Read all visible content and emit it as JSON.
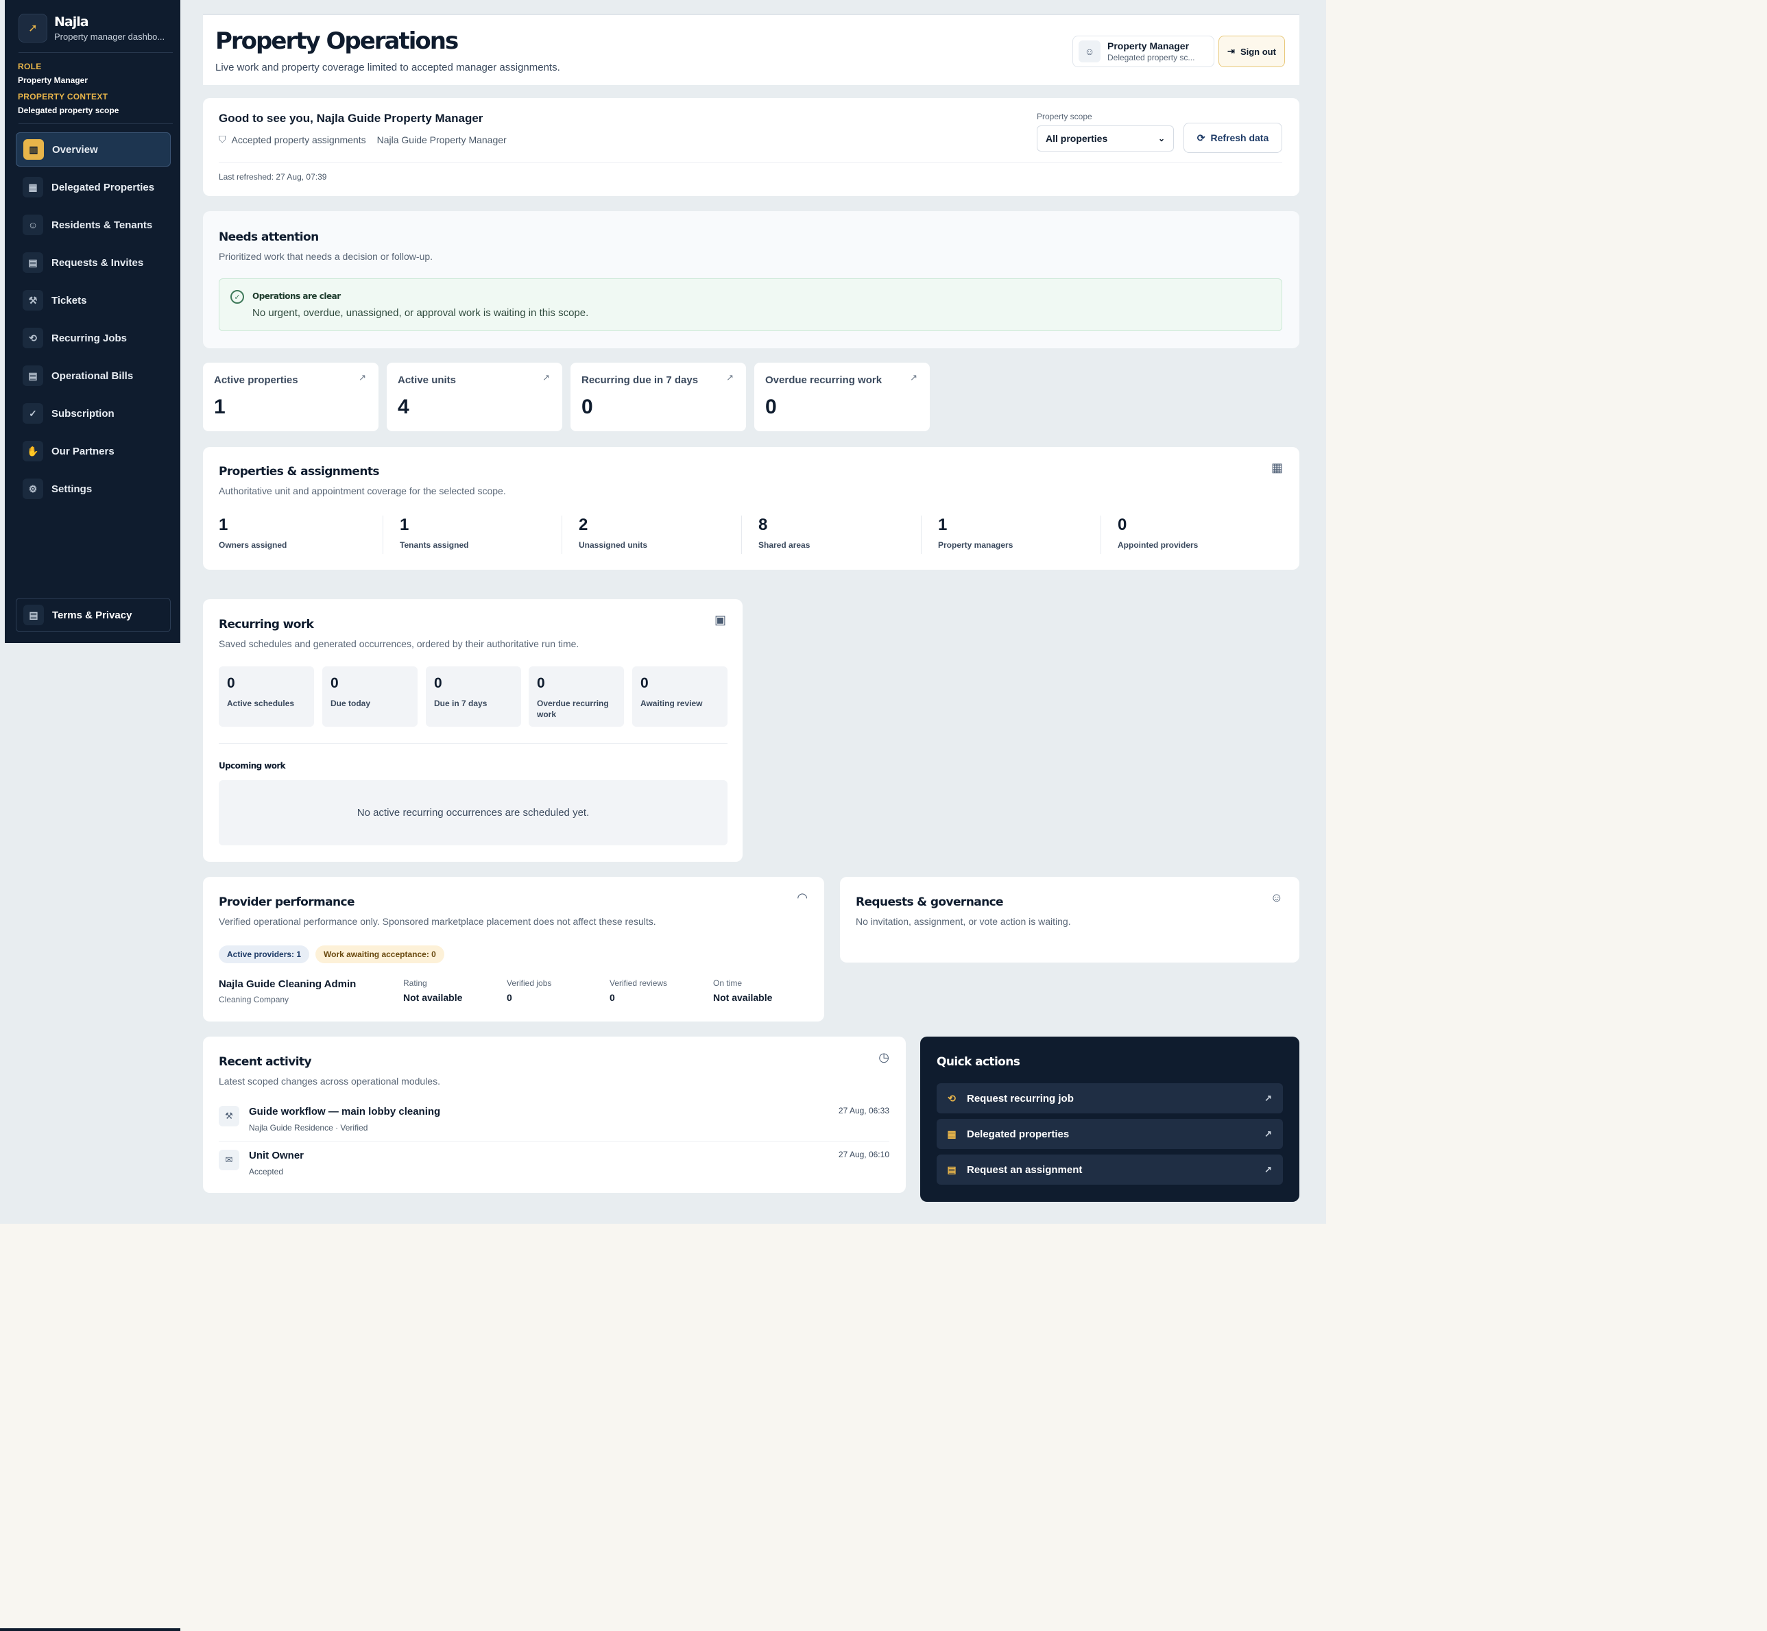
{
  "sidebar": {
    "brand_name": "Najla",
    "brand_sub": "Property manager dashbo...",
    "role_label": "ROLE",
    "role_value": "Property Manager",
    "context_label": "PROPERTY CONTEXT",
    "context_value": "Delegated property scope",
    "items": [
      {
        "label": "Overview",
        "icon": "bar-chart-icon",
        "active": true
      },
      {
        "label": "Delegated Properties",
        "icon": "building-icon"
      },
      {
        "label": "Residents & Tenants",
        "icon": "users-icon"
      },
      {
        "label": "Requests & Invites",
        "icon": "clipboard-icon"
      },
      {
        "label": "Tickets",
        "icon": "wrench-icon"
      },
      {
        "label": "Recurring Jobs",
        "icon": "repeat-icon"
      },
      {
        "label": "Operational Bills",
        "icon": "receipt-icon"
      },
      {
        "label": "Subscription",
        "icon": "check-circle-icon"
      },
      {
        "label": "Our Partners",
        "icon": "handshake-icon"
      },
      {
        "label": "Settings",
        "icon": "gear-icon"
      }
    ],
    "terms": "Terms & Privacy"
  },
  "header": {
    "title": "Property Operations",
    "subtitle": "Live work and property coverage limited to accepted manager assignments.",
    "user_name": "Property Manager",
    "user_scope": "Delegated property sc...",
    "sign_out": "Sign out"
  },
  "greeting": {
    "title": "Good to see you, Najla Guide Property Manager",
    "meta_assignments": "Accepted property assignments",
    "meta_name": "Najla Guide Property Manager",
    "scope_label": "Property scope",
    "scope_value": "All properties",
    "refresh": "Refresh data",
    "last_refreshed": "Last refreshed: 27 Aug, 07:39"
  },
  "attention": {
    "title": "Needs attention",
    "subtitle": "Prioritized work that needs a decision or follow-up.",
    "clear_title": "Operations are clear",
    "clear_text": "No urgent, overdue, unassigned, or approval work is waiting in this scope."
  },
  "stats": [
    {
      "label": "Active properties",
      "value": "1"
    },
    {
      "label": "Active units",
      "value": "4"
    },
    {
      "label": "Recurring due in 7 days",
      "value": "0"
    },
    {
      "label": "Overdue recurring work",
      "value": "0"
    }
  ],
  "properties": {
    "title": "Properties & assignments",
    "subtitle": "Authoritative unit and appointment coverage for the selected scope.",
    "cells": [
      {
        "value": "1",
        "label": "Owners assigned"
      },
      {
        "value": "1",
        "label": "Tenants assigned"
      },
      {
        "value": "2",
        "label": "Unassigned units"
      },
      {
        "value": "8",
        "label": "Shared areas"
      },
      {
        "value": "1",
        "label": "Property managers"
      },
      {
        "value": "0",
        "label": "Appointed providers"
      }
    ]
  },
  "recurring": {
    "title": "Recurring work",
    "subtitle": "Saved schedules and generated occurrences, ordered by their authoritative run time.",
    "tiles": [
      {
        "value": "0",
        "label": "Active schedules"
      },
      {
        "value": "0",
        "label": "Due today"
      },
      {
        "value": "0",
        "label": "Due in 7 days"
      },
      {
        "value": "0",
        "label": "Overdue recurring work"
      },
      {
        "value": "0",
        "label": "Awaiting review"
      }
    ],
    "upcoming_title": "Upcoming work",
    "upcoming_empty": "No active recurring occurrences are scheduled yet."
  },
  "provider": {
    "title": "Provider performance",
    "subtitle": "Verified operational performance only. Sponsored marketplace placement does not affect these results.",
    "pill_active": "Active providers: 1",
    "pill_waiting": "Work awaiting acceptance: 0",
    "name": "Najla Guide Cleaning Admin",
    "type": "Cleaning Company",
    "columns": [
      {
        "label": "Rating",
        "value": "Not available"
      },
      {
        "label": "Verified jobs",
        "value": "0"
      },
      {
        "label": "Verified reviews",
        "value": "0"
      },
      {
        "label": "On time",
        "value": "Not available"
      }
    ]
  },
  "requests": {
    "title": "Requests & governance",
    "subtitle": "No invitation, assignment, or vote action is waiting."
  },
  "activity": {
    "title": "Recent activity",
    "subtitle": "Latest scoped changes across operational modules.",
    "rows": [
      {
        "title": "Guide workflow — main lobby cleaning",
        "sub": "Najla Guide Residence · Verified",
        "time": "27 Aug, 06:33",
        "icon": "wrench-icon"
      },
      {
        "title": "Unit Owner",
        "sub": "Accepted",
        "time": "27 Aug, 06:10",
        "icon": "mail-icon"
      }
    ]
  },
  "quick": {
    "title": "Quick actions",
    "items": [
      {
        "label": "Request recurring job",
        "icon": "repeat-icon"
      },
      {
        "label": "Delegated properties",
        "icon": "building-icon"
      },
      {
        "label": "Request an assignment",
        "icon": "clipboard-icon"
      }
    ]
  },
  "colors": {
    "navy": "#0f1c2e",
    "accent_gold": "#e8b54a",
    "success_green": "#3f7a5a",
    "backdrop": "#e8edf0"
  }
}
